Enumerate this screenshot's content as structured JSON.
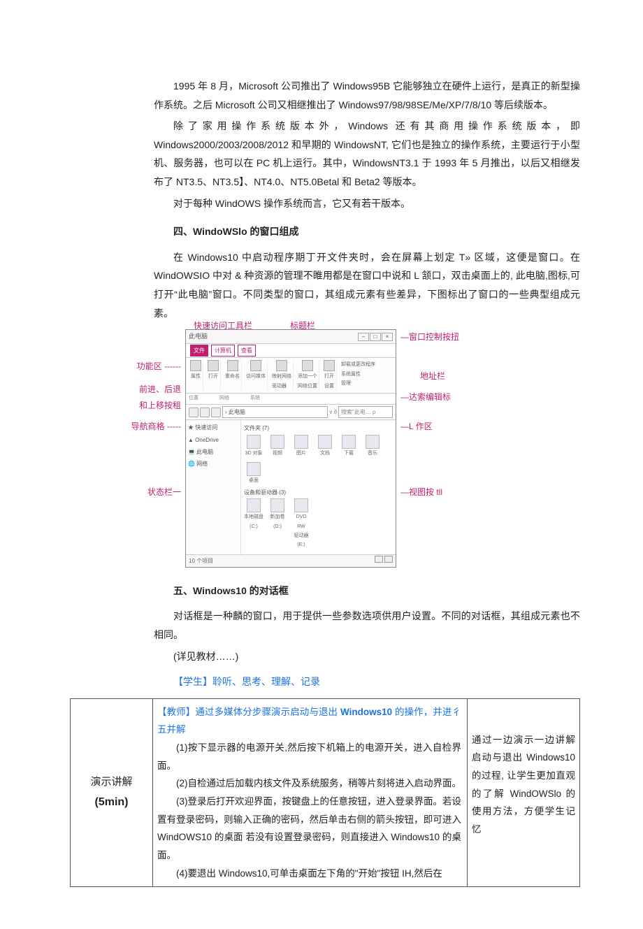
{
  "paragraphs": {
    "p1": "1995 年 8 月，Microsoft 公司推出了 Windows95B 它能够独立在硬件上运行，是真正的新型操作系统。之后 Microsoft 公司又相继推出了 Windows97/98/98SE/Me/XP/7/8/10 等后续版本。",
    "p2": "除了家用操作系统版本外，Windows 还有其商用操作系统版本，即 Windows2000/2003/2008/2012 和早期的 WindowsNT, 它们也是独立的操作系统，主要运行于小型机、服务器，也可以在 PC 机上运行。其中，WindowsNT3.1 于 1993 年 5 月推出，以后又相继发布了 NT3.5、NT3.5】、NT4.0、NT5.0Betal 和 Beta2 等版本。",
    "p3": "对于每种 WindOWS 操作系统而言，它又有若干版本。"
  },
  "section4": {
    "title": "四、WindoWSlo 的窗口组成",
    "p1": "在 Windows10 中启动程序期丁开文件夹时，会在屏幕上划定 T» 区域，这便是窗口。在 WindOWSIO 中对 & 种资源的管理不睢用都是在窗口中说和 L 颔口，双击桌面上的, 此电脑,图标,可打开“此电脑”窗口。不同类型的窗口，其组成元素有些差异，下图标出了窗口的一些典型组成元素。"
  },
  "figure": {
    "top": {
      "qat": "快速访问工具栏",
      "titlebar": "标题栏"
    },
    "right": {
      "ctrl": "窗口控制按扭",
      "addr": "地址栏",
      "search": "达索编辑标",
      "work": "L 作区",
      "view": "视图按 tll"
    },
    "left": {
      "ribbon": "功能区",
      "navbtn": "前进、后退\n和上移按租",
      "navpane": "导航商格",
      "status": "状态栏一"
    },
    "window": {
      "title": "此电脑",
      "tabs": [
        "文件",
        "计算机",
        "查看"
      ],
      "ribbon": [
        {
          "label": "属性"
        },
        {
          "label": "打开"
        },
        {
          "label": "重命名"
        },
        {
          "label": "访问媒体"
        },
        {
          "label": "映射网络\n驱动器"
        },
        {
          "label": "添加一个\n网络位置"
        },
        {
          "label": "打开\n设置"
        },
        {
          "label": "卸载或更改程序\n系统属性\n管理"
        }
      ],
      "ribbon_groups": [
        "位置",
        "网络",
        "系统"
      ],
      "path": "› 此电脑",
      "search": "搜索\"此电… ρ",
      "side": [
        "★ 快速访问",
        "▲ OneDrive",
        "💻 此电脑",
        "🌐 网络"
      ],
      "folders_title": "文件夹 (7)",
      "folders": [
        "3D 对象",
        "视频",
        "图片",
        "文档",
        "下载",
        "音乐",
        "桌面"
      ],
      "devices_title": "设备和驱动器 (3)",
      "devices": [
        "本地磁盘\n(C:)",
        "新加卷 (D:)",
        "DVD RW\n驱动器 (E:)"
      ],
      "status_left": "10 个项目",
      "status_right": ""
    }
  },
  "section5": {
    "title": "五、Windows10 的对话框",
    "p1": "对话框是一种麟的窗口，用于提供一些参数选项供用户设置。不同的对话框，其组成元素也不相同。",
    "p2": "(详见教材……)"
  },
  "student": "【学生】聆听、思考、理解、记录",
  "lesson": {
    "left": {
      "title": "演示讲解",
      "time": "(5min)"
    },
    "mid": {
      "lead_prefix": "【教师】通过多媒体分步骤演示启动与退出 ",
      "lead_bold": "Windows10",
      "lead_suffix": " 的操作，并进彳五并解",
      "s1": "(1)按下显示器的电源开关,然后按下机箱上的电源开关，进入自检界面。",
      "s2": "(2)自检通过后加载内核文件及系统服务，稍等片刻将进入启动界面。",
      "s3": "(3)登录后打开欢迎界面，按键盘上的任意按钮，进入登录界面。若设置有登录密码，则输入正确的密码，然后单击右侧的箭头按钮，即可进入 WindOWS10 的桌面 若没有设置登录密码，则直接进入 Windows10 的桌面。",
      "s4": "(4)要退出 Windows10,可单击桌面左下角的\"开始\"按钮 IH,然后在"
    },
    "right": "通过一边演示一边讲解启动与退出 Windows10 的过程, 让学生更加直观的了解 WindOWSlo 的使用方法，方便学生记忆"
  }
}
